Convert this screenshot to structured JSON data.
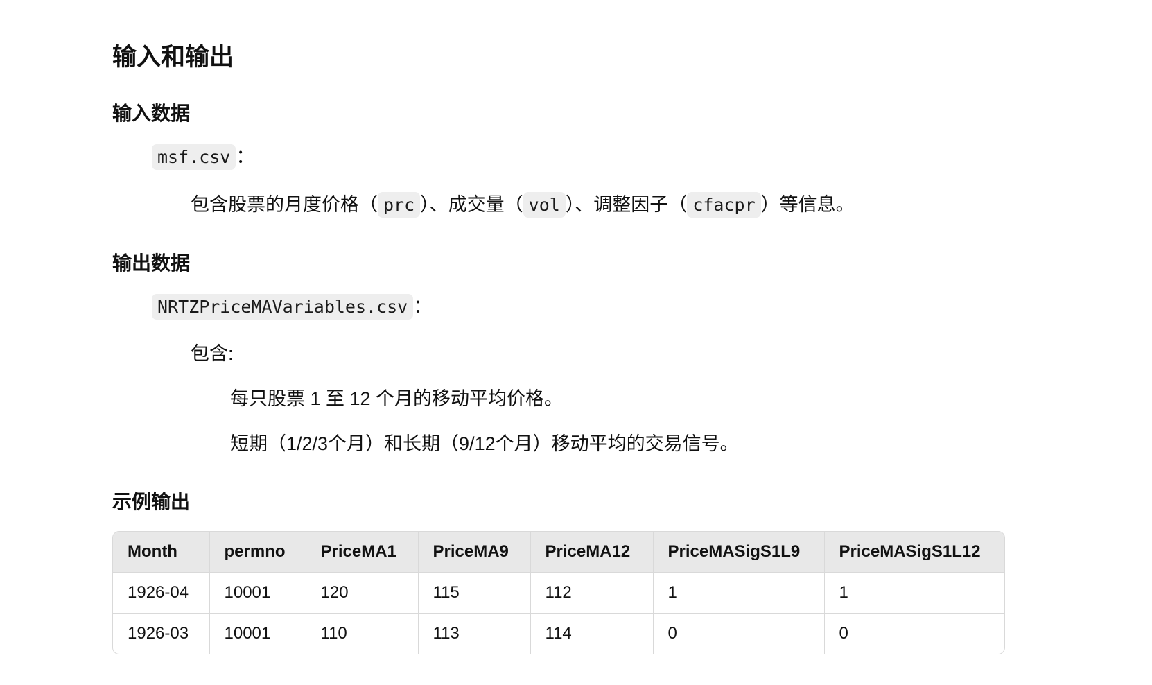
{
  "heading": "输入和输出",
  "input": {
    "title": "输入数据",
    "file": "msf.csv",
    "colon": "：",
    "desc": {
      "p1": "包含股票的月度价格（",
      "c1": "prc",
      "p2": "）、成交量（",
      "c2": "vol",
      "p3": "）、调整因子（",
      "c3": "cfacpr",
      "p4": "）等信息。"
    }
  },
  "output": {
    "title": "输出数据",
    "file": "NRTZPriceMAVariables.csv",
    "colon": "：",
    "contains": "包含:",
    "items": [
      "每只股票 1 至 12 个月的移动平均价格。",
      "短期（1/2/3个月）和长期（9/12个月）移动平均的交易信号。"
    ]
  },
  "example": {
    "title": "示例输出",
    "headers": [
      "Month",
      "permno",
      "PriceMA1",
      "PriceMA9",
      "PriceMA12",
      "PriceMASigS1L9",
      "PriceMASigS1L12"
    ],
    "rows": [
      [
        "1926-04",
        "10001",
        "120",
        "115",
        "112",
        "1",
        "1"
      ],
      [
        "1926-03",
        "10001",
        "110",
        "113",
        "114",
        "0",
        "0"
      ]
    ]
  }
}
